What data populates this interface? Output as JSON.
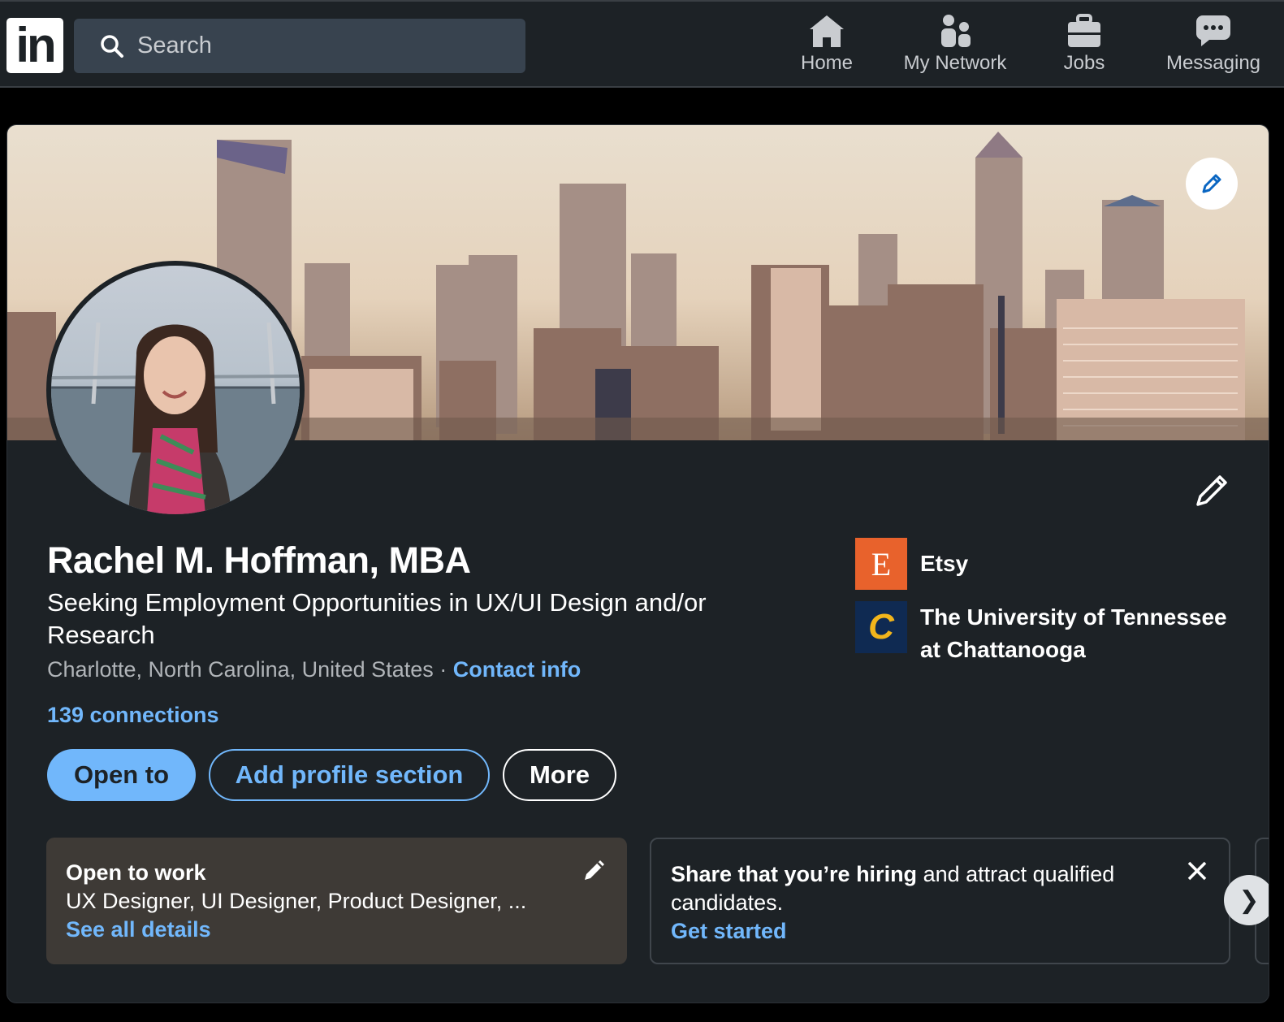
{
  "nav": {
    "logo_text": "in",
    "search_placeholder": "Search",
    "items": [
      {
        "label": "Home",
        "icon": "home-icon"
      },
      {
        "label": "My Network",
        "icon": "network-icon"
      },
      {
        "label": "Jobs",
        "icon": "briefcase-icon"
      },
      {
        "label": "Messaging",
        "icon": "messaging-icon"
      }
    ]
  },
  "profile": {
    "name": "Rachel M. Hoffman, MBA",
    "headline": "Seeking Employment Opportunities in UX/UI Design and/or Research",
    "location": "Charlotte, North Carolina, United States",
    "separator": " · ",
    "contact_info": "Contact info",
    "connections": "139 connections",
    "buttons": {
      "open_to": "Open to",
      "add_section": "Add profile section",
      "more": "More"
    },
    "organizations": [
      {
        "name": "Etsy",
        "logo_letter": "E",
        "logo_color": "#e8622c"
      },
      {
        "name": "The University of Tennessee at Chattanooga",
        "logo_letter": "C",
        "logo_color": "#0f2a52"
      }
    ]
  },
  "open_to_work": {
    "title": "Open to work",
    "roles": "UX Designer, UI Designer, Product Designer, ...",
    "link": "See all details"
  },
  "hiring": {
    "title_bold": "Share that you’re hiring",
    "title_rest": " and attract qualified candidates.",
    "link": "Get started"
  },
  "carousel": {
    "next_symbol": "❯"
  },
  "colors": {
    "accent_blue": "#71b7fb",
    "card_bg": "#1d2226",
    "page_bg": "#000000"
  }
}
